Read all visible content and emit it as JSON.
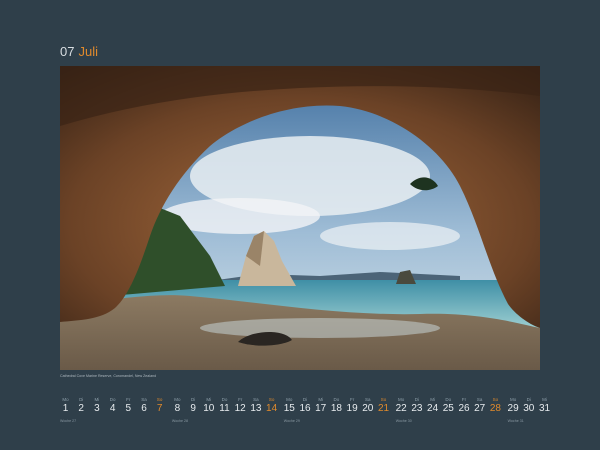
{
  "header": {
    "month_number": "07",
    "month_name": "Juli"
  },
  "photo": {
    "subject": "Cathedral Cove sea arch framing a rock stack and beach"
  },
  "caption": "Cathedral Cove Marine Reserve, Coromandel, New Zealand",
  "calendar": {
    "days": [
      {
        "d": "1",
        "wd": "Mo"
      },
      {
        "d": "2",
        "wd": "Di"
      },
      {
        "d": "3",
        "wd": "Mi"
      },
      {
        "d": "4",
        "wd": "Do"
      },
      {
        "d": "5",
        "wd": "Fr"
      },
      {
        "d": "6",
        "wd": "Sa"
      },
      {
        "d": "7",
        "wd": "So"
      },
      {
        "d": "8",
        "wd": "Mo"
      },
      {
        "d": "9",
        "wd": "Di"
      },
      {
        "d": "10",
        "wd": "Mi"
      },
      {
        "d": "11",
        "wd": "Do"
      },
      {
        "d": "12",
        "wd": "Fr"
      },
      {
        "d": "13",
        "wd": "Sa"
      },
      {
        "d": "14",
        "wd": "So"
      },
      {
        "d": "15",
        "wd": "Mo"
      },
      {
        "d": "16",
        "wd": "Di"
      },
      {
        "d": "17",
        "wd": "Mi"
      },
      {
        "d": "18",
        "wd": "Do"
      },
      {
        "d": "19",
        "wd": "Fr"
      },
      {
        "d": "20",
        "wd": "Sa"
      },
      {
        "d": "21",
        "wd": "So"
      },
      {
        "d": "22",
        "wd": "Mo"
      },
      {
        "d": "23",
        "wd": "Di"
      },
      {
        "d": "24",
        "wd": "Mi"
      },
      {
        "d": "25",
        "wd": "Do"
      },
      {
        "d": "26",
        "wd": "Fr"
      },
      {
        "d": "27",
        "wd": "Sa"
      },
      {
        "d": "28",
        "wd": "So"
      },
      {
        "d": "29",
        "wd": "Mo"
      },
      {
        "d": "30",
        "wd": "Di"
      },
      {
        "d": "31",
        "wd": "Mi"
      }
    ],
    "weeks": [
      "Woche 27",
      "Woche 28",
      "Woche 29",
      "Woche 30",
      "Woche 31"
    ]
  },
  "colors": {
    "background": "#2f3f4a",
    "accent": "#e08a2c",
    "text": "#e7ebee"
  }
}
